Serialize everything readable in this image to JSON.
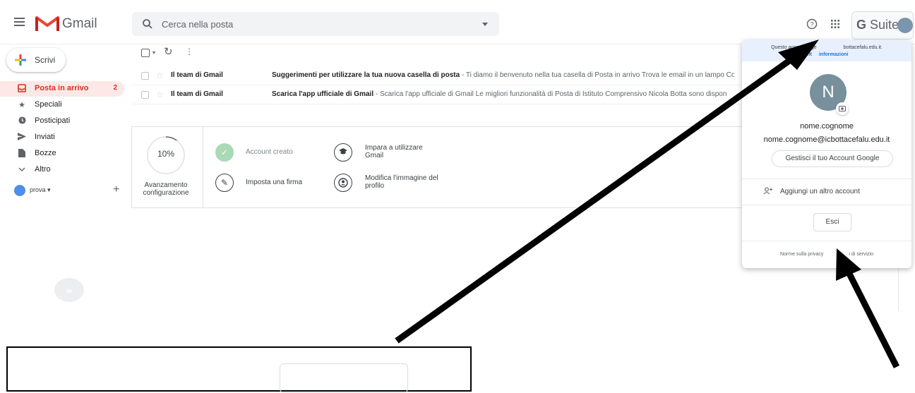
{
  "header": {
    "app_name": "Gmail",
    "search_placeholder": "Cerca nella posta",
    "gsuite_label": "Suite",
    "gsuite_g": "G"
  },
  "sidebar": {
    "compose_label": "Scrivi",
    "items": [
      {
        "label": "Posta in arrivo",
        "count": "2",
        "icon": "inbox-icon",
        "active": true
      },
      {
        "label": "Speciali",
        "icon": "star-icon"
      },
      {
        "label": "Posticipati",
        "icon": "clock-icon"
      },
      {
        "label": "Inviati",
        "icon": "send-icon"
      },
      {
        "label": "Bozze",
        "icon": "draft-icon"
      },
      {
        "label": "Altro",
        "icon": "chevron-down-icon"
      }
    ],
    "user_label": "prova"
  },
  "emails": [
    {
      "sender": "Il team di Gmail",
      "subject": "Suggerimenti per utilizzare la tua nuova casella di posta",
      "snippet": " - Ti diamo il benvenuto nella tua casella di Posta in arrivo Trova le email in un lampo Co"
    },
    {
      "sender": "Il team di Gmail",
      "subject": "Scarica l'app ufficiale di Gmail",
      "snippet": " - Scarica l'app ufficiale di Gmail Le migliori funzionalità di Posta di Istituto Comprensivo Nicola Botta sono dispon"
    }
  ],
  "setup": {
    "progress": "10%",
    "progress_fraction": 0.1,
    "progress_caption": "Avanzamento configurazione",
    "tasks": [
      {
        "label": "Account creato",
        "done": true,
        "icon": "check-icon"
      },
      {
        "label": "Imposta una firma",
        "icon": "pen-icon"
      },
      {
        "label": "Impara a utilizzare Gmail",
        "icon": "graduation-cap-icon"
      },
      {
        "label": "Modifica l'immagine del profilo",
        "icon": "profile-icon"
      }
    ]
  },
  "account_menu": {
    "banner_text": "Questo account è ge",
    "banner_text_end": "bottacefalu.edu.it.",
    "banner_link_start": "Ult",
    "banner_link_end": "informazioni",
    "avatar_letter": "N",
    "name": "nome.cognome",
    "email": "nome.cognome@icbottacefalu.edu.it",
    "manage_button": "Gestisci il tuo Account Google",
    "add_account": "Aggiungi un altro account",
    "logout_button": "Esci",
    "footer_privacy": "Norme sulla privacy",
    "footer_terms": "i di servizio"
  },
  "colors": {
    "accent_red": "#d93025",
    "active_bg": "#fce8e6",
    "link_blue": "#1a73e8"
  }
}
